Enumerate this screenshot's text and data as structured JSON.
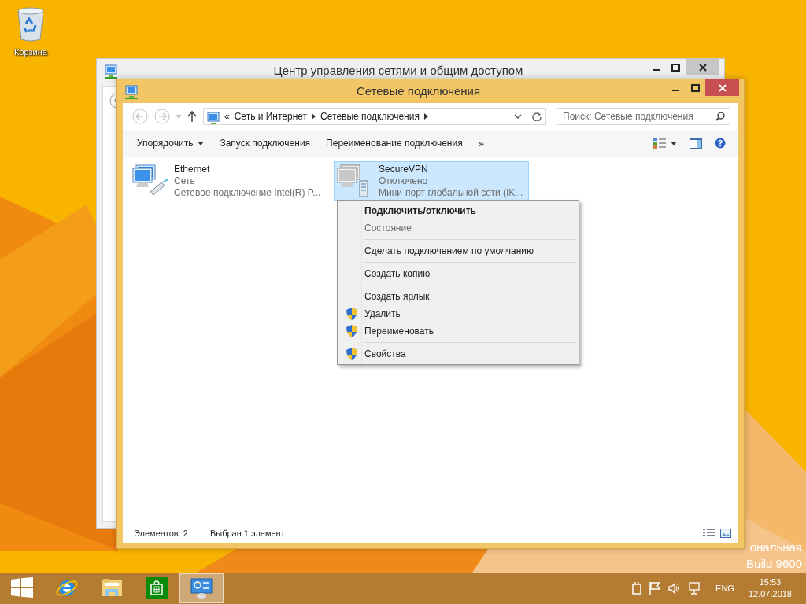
{
  "desktop": {
    "icons": [
      {
        "label": "Корзина"
      }
    ],
    "edition_text": [
      "ональная",
      "Build 9600"
    ]
  },
  "background_window": {
    "title": "Центр управления сетями и общим доступом"
  },
  "window": {
    "title": "Сетевые подключения",
    "address": {
      "prefix": "«",
      "crumbs": [
        "Сеть и Интернет",
        "Сетевые подключения"
      ]
    },
    "search": {
      "placeholder": "Поиск: Сетевые подключения"
    },
    "toolbar": [
      {
        "label": "Упорядочить",
        "kind": "menu"
      },
      {
        "label": "Запуск подключения",
        "kind": "command"
      },
      {
        "label": "Переименование подключения",
        "kind": "command"
      },
      {
        "label": "»",
        "kind": "overflow"
      }
    ],
    "items": [
      {
        "kind": "ethernet",
        "name": "Ethernet",
        "status": "Сеть",
        "device": "Сетевое подключение Intel(R) P...",
        "selected": false
      },
      {
        "kind": "vpn",
        "name": "SecureVPN",
        "status": "Отключено",
        "device": "Мини-порт глобальной сети (IK...",
        "selected": true
      }
    ],
    "status_bar": [
      "Элементов: 2",
      "Выбран 1 элемент"
    ]
  },
  "context_menu": {
    "items": [
      {
        "kind": "item",
        "label": "Подключить/отключить",
        "default": true,
        "disabled": false,
        "shield": false
      },
      {
        "kind": "item",
        "label": "Состояние",
        "default": false,
        "disabled": true,
        "shield": false
      },
      {
        "kind": "separator"
      },
      {
        "kind": "item",
        "label": "Сделать подключением по умолчанию",
        "default": false,
        "disabled": false,
        "shield": false
      },
      {
        "kind": "separator"
      },
      {
        "kind": "item",
        "label": "Создать копию",
        "default": false,
        "disabled": false,
        "shield": false
      },
      {
        "kind": "separator"
      },
      {
        "kind": "item",
        "label": "Создать ярлык",
        "default": false,
        "disabled": false,
        "shield": false
      },
      {
        "kind": "item",
        "label": "Удалить",
        "default": false,
        "disabled": false,
        "shield": true
      },
      {
        "kind": "item",
        "label": "Переименовать",
        "default": false,
        "disabled": false,
        "shield": true
      },
      {
        "kind": "separator"
      },
      {
        "kind": "item",
        "label": "Свойства",
        "default": false,
        "disabled": false,
        "shield": true
      }
    ]
  },
  "taskbar": {
    "apps": [
      {
        "kind": "start",
        "selected": false
      },
      {
        "kind": "browser",
        "selected": false
      },
      {
        "kind": "explorer",
        "selected": false
      },
      {
        "kind": "store",
        "selected": false
      },
      {
        "kind": "control-panel",
        "selected": true
      }
    ],
    "language": "ENG",
    "time": "15:53",
    "date": "12.07.2018"
  }
}
